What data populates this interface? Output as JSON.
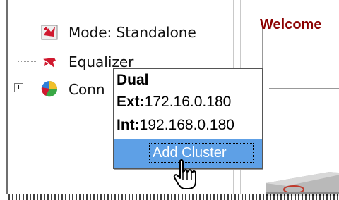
{
  "tree": {
    "items": [
      {
        "label": "Mode: Standalone",
        "icon": "standalone-mode-icon"
      },
      {
        "label": "Equalizer",
        "icon": "equalizer-icon"
      },
      {
        "label": "Conn",
        "icon": "connections-pie-icon"
      }
    ],
    "expander_symbol": "+"
  },
  "header": {
    "welcome": "Welcome"
  },
  "tooltip": {
    "title": "Dual",
    "ext_label": "Ext:",
    "ext_value": "172.16.0.180",
    "int_label": "Int:",
    "int_value": "192.168.0.180",
    "action": "Add Cluster"
  },
  "colors": {
    "accent": "#5ea0e6",
    "welcome": "#8b0000"
  }
}
